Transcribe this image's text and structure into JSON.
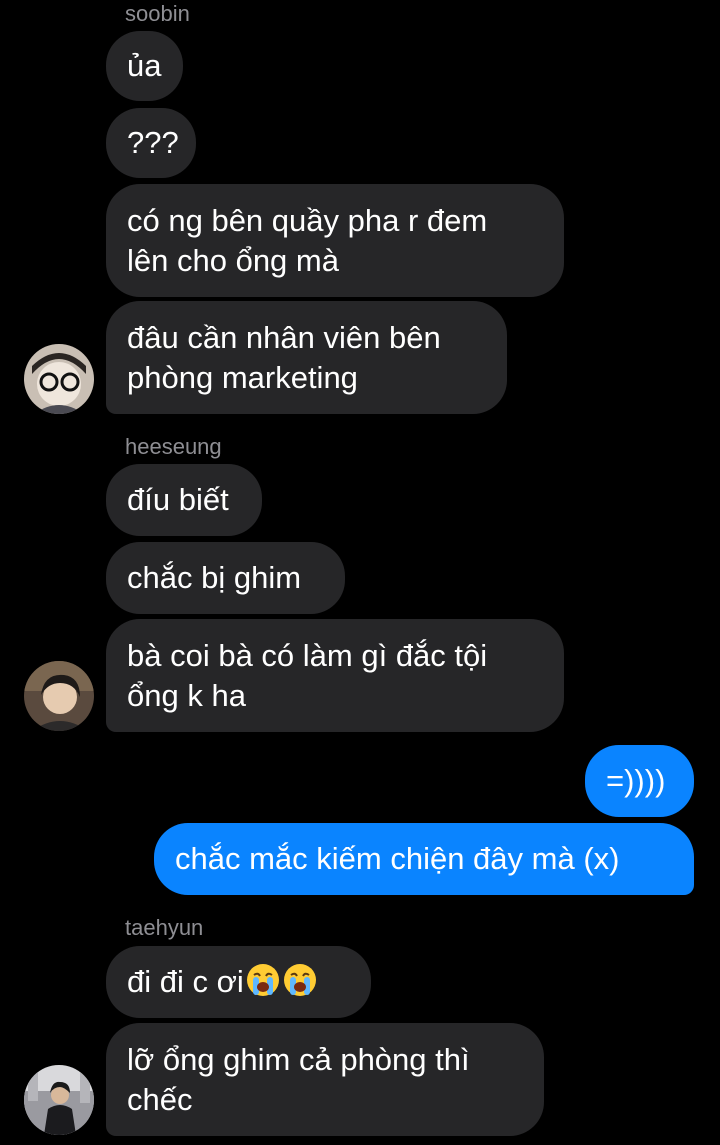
{
  "thread": {
    "groups": [
      {
        "sender": "soobin",
        "avatar_icon": "avatar-soobin",
        "messages": [
          {
            "lines": [
              "ủa"
            ]
          },
          {
            "lines": [
              "???"
            ]
          },
          {
            "lines": [
              "có ng bên quầy pha r đem",
              "lên cho ổng mà"
            ]
          },
          {
            "lines": [
              "đâu cần nhân viên bên",
              "phòng marketing"
            ]
          }
        ]
      },
      {
        "sender": "heeseung",
        "avatar_icon": "avatar-heeseung",
        "messages": [
          {
            "lines": [
              "đíu biết"
            ]
          },
          {
            "lines": [
              "chắc bị ghim"
            ]
          },
          {
            "lines": [
              "bà coi bà có làm gì đắc tội",
              "ổng k ha"
            ]
          }
        ]
      },
      {
        "sender": "me",
        "messages": [
          {
            "lines": [
              "=))))"
            ]
          },
          {
            "lines": [
              "chắc mắc kiếm chiện đây mà (x)"
            ]
          }
        ]
      },
      {
        "sender": "taehyun",
        "avatar_icon": "avatar-taehyun",
        "messages": [
          {
            "lines": [
              "đi đi c ơi"
            ],
            "emoji": [
              "loudly-crying-face-icon",
              "loudly-crying-face-icon"
            ]
          },
          {
            "lines": [
              "lỡ ổng ghim cả phòng thì",
              "chếc"
            ]
          }
        ]
      }
    ]
  },
  "colors": {
    "background": "#000000",
    "incoming_bubble": "#262628",
    "outgoing_bubble": "#0a84ff",
    "sender_name": "#8e8e93",
    "text": "#ffffff"
  }
}
